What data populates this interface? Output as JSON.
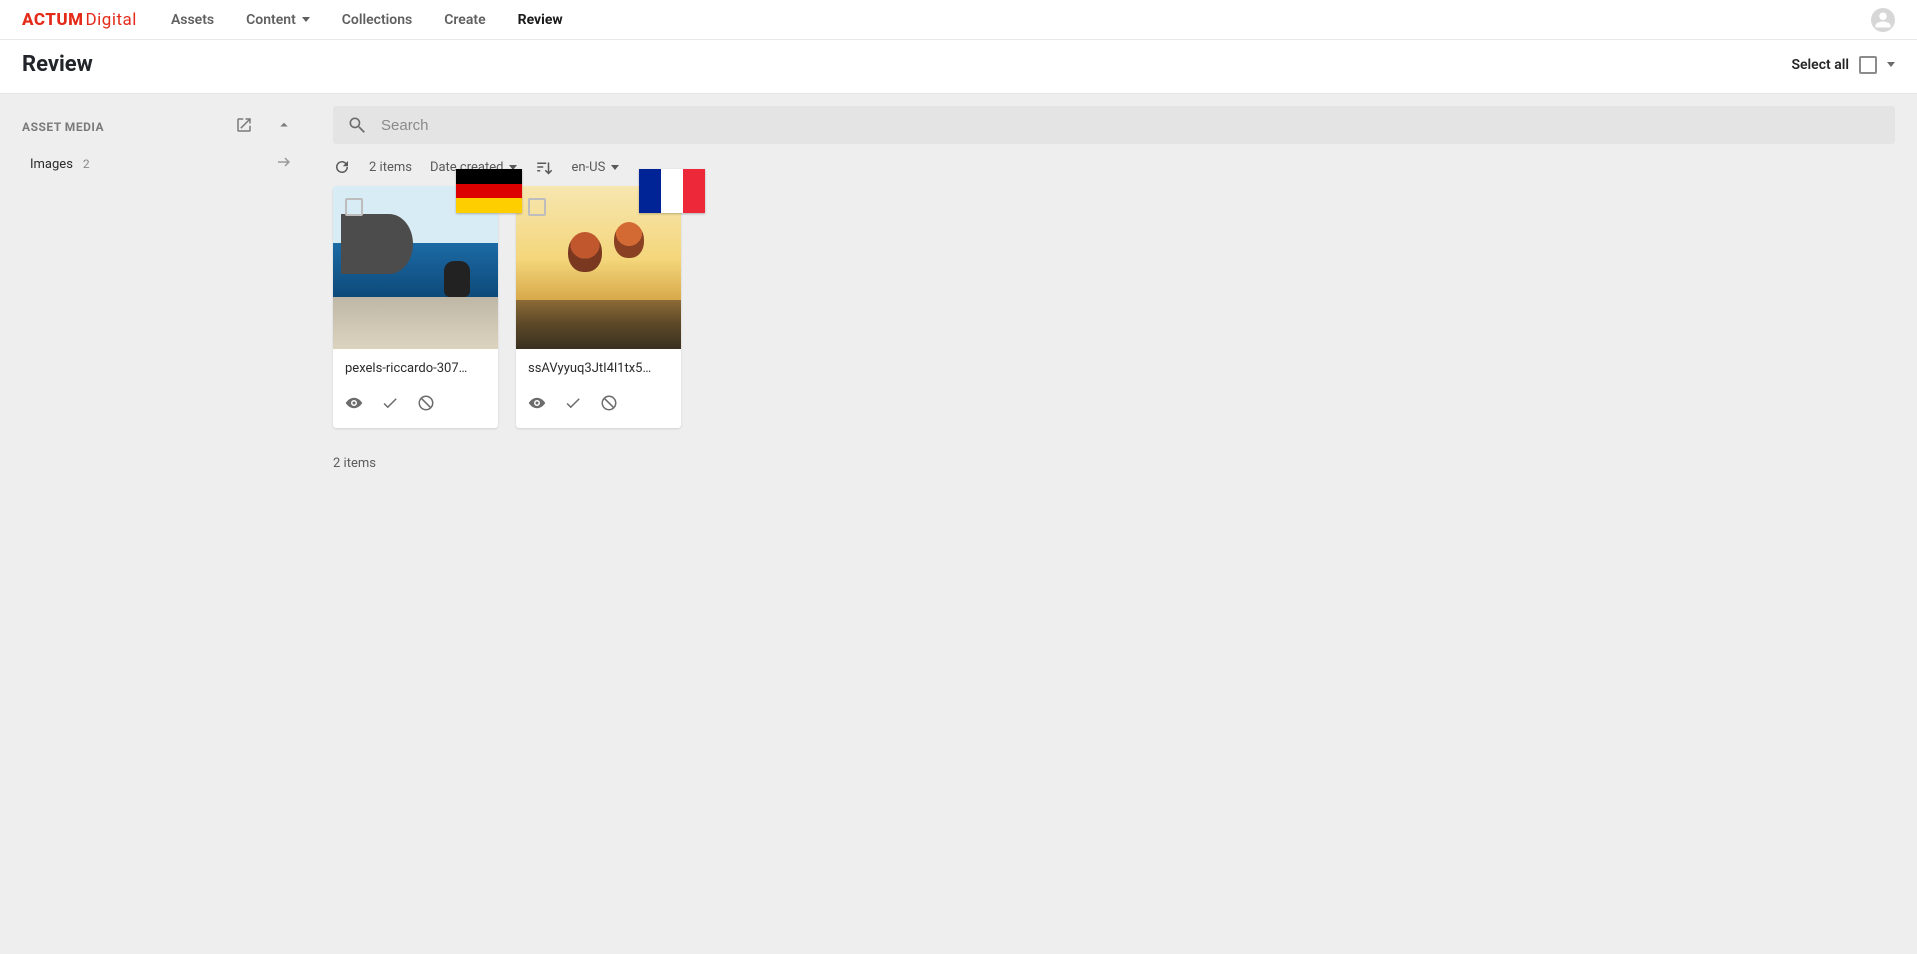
{
  "brand": {
    "part1": "ACTUM",
    "part2": "Digital"
  },
  "nav": {
    "assets": "Assets",
    "content": "Content",
    "collections": "Collections",
    "create": "Create",
    "review": "Review"
  },
  "page": {
    "title": "Review",
    "select_all": "Select all"
  },
  "sidebar": {
    "header": "ASSET MEDIA",
    "item_label": "Images",
    "item_count": "2"
  },
  "search": {
    "placeholder": "Search"
  },
  "toolbar": {
    "item_count": "2 items",
    "sort_label": "Date created",
    "locale": "en-US"
  },
  "cards": [
    {
      "title": "pexels-riccardo-307…",
      "flag": "de"
    },
    {
      "title": "ssAVyyuq3JtI4l1tx5…",
      "flag": "fr"
    }
  ],
  "footer": {
    "count": "2 items"
  }
}
